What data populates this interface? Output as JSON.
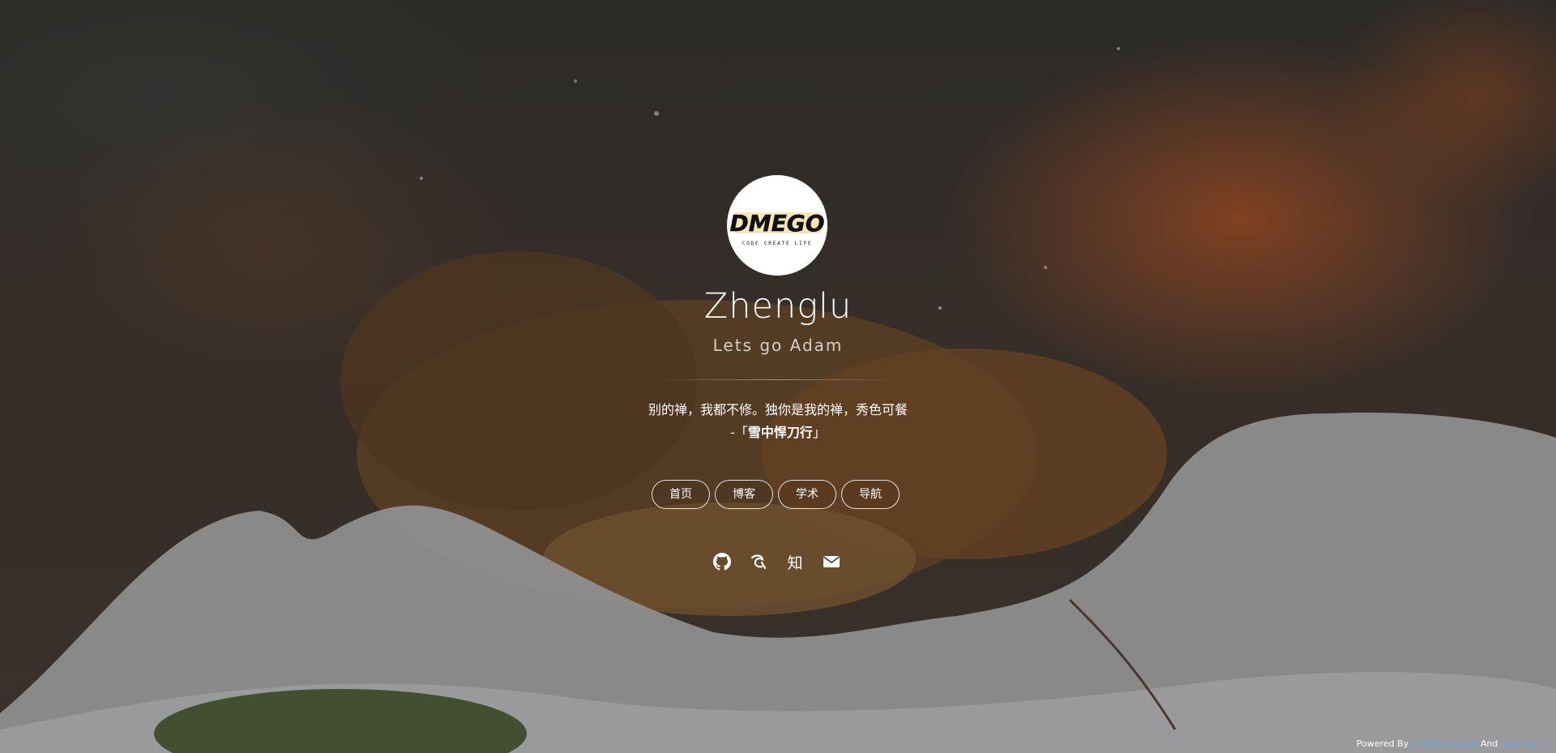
{
  "profile": {
    "logo_text": "DMEGO",
    "logo_tagline": "CODE CREATE LIFE",
    "name": "Zhenglu",
    "subtitle": "Lets go Adam"
  },
  "quote": {
    "text": "别的禅，我都不修。独你是我的禅，秀色可餐",
    "prefix": "-「",
    "source": "雪中悍刀行",
    "suffix": "」"
  },
  "nav": {
    "items": [
      {
        "label": "首页"
      },
      {
        "label": "博客"
      },
      {
        "label": "学术"
      },
      {
        "label": "导航"
      }
    ]
  },
  "socials": {
    "github_icon": "github-icon",
    "csdn_icon": "csdn-icon",
    "zhihu_label": "知",
    "mail_icon": "mail-icon"
  },
  "footer": {
    "powered_by": "Powered By ",
    "link1": "GitHub Actions",
    "and": " And ",
    "link2": "Hitokoto"
  },
  "colors": {
    "link": "#6fa8dc",
    "text": "#ffffff"
  }
}
